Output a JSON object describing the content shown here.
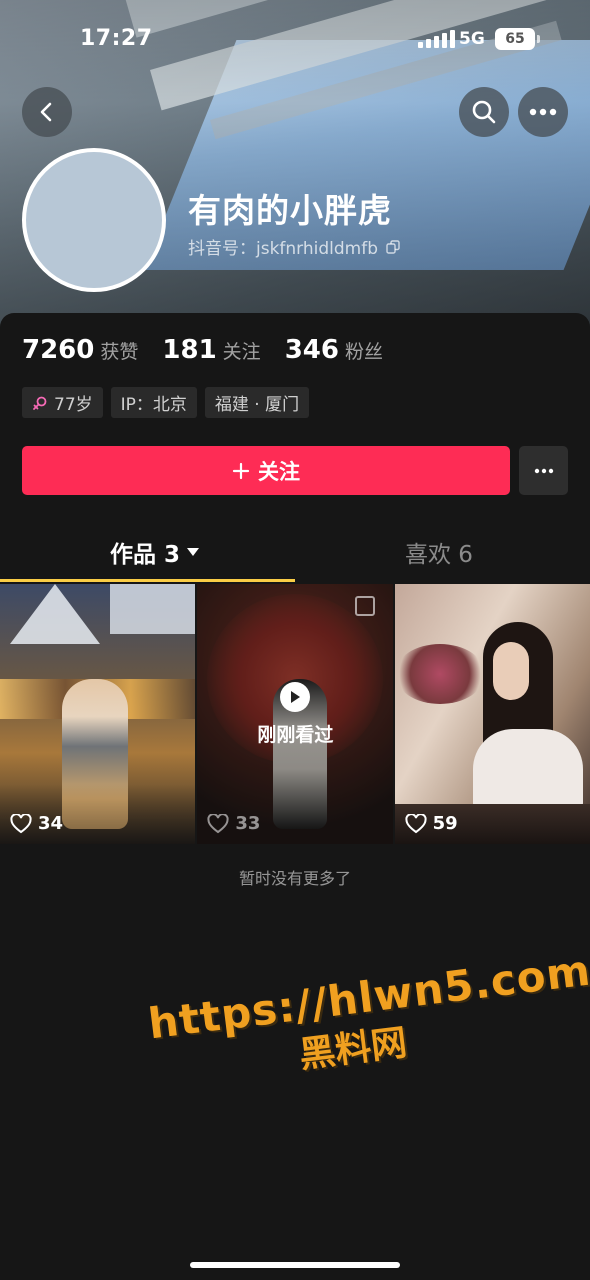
{
  "status_bar": {
    "time": "17:27",
    "network": "5G",
    "battery": "65"
  },
  "header": {
    "back_icon": "chevron-left-icon",
    "search_icon": "search-icon",
    "more_icon": "more-dots-icon"
  },
  "profile": {
    "nickname": "有肉的小胖虎",
    "douyin_id": "抖音号：jskfnrhidldmfb"
  },
  "stats": [
    {
      "value": "7260",
      "label": "获赞"
    },
    {
      "value": "181",
      "label": "关注"
    },
    {
      "value": "346",
      "label": "粉丝"
    }
  ],
  "tags": [
    {
      "text": "77岁",
      "icon": "female-icon"
    },
    {
      "text": "IP：北京"
    },
    {
      "text": "福建 · 厦门"
    }
  ],
  "actions": {
    "follow_label": "关注"
  },
  "tabs": {
    "works": "作品 3",
    "likes": "喜欢 6"
  },
  "videos": [
    {
      "likes": "34"
    },
    {
      "likes": "33",
      "overlay": "刚刚看过"
    },
    {
      "likes": "59"
    }
  ],
  "footer_text": "暂时没有更多了",
  "watermark": {
    "url": "https://hlwn5.com",
    "name": "黑料网"
  },
  "colors": {
    "accent": "#fe2c55",
    "tab_underline": "#facd46",
    "background": "#161616"
  }
}
